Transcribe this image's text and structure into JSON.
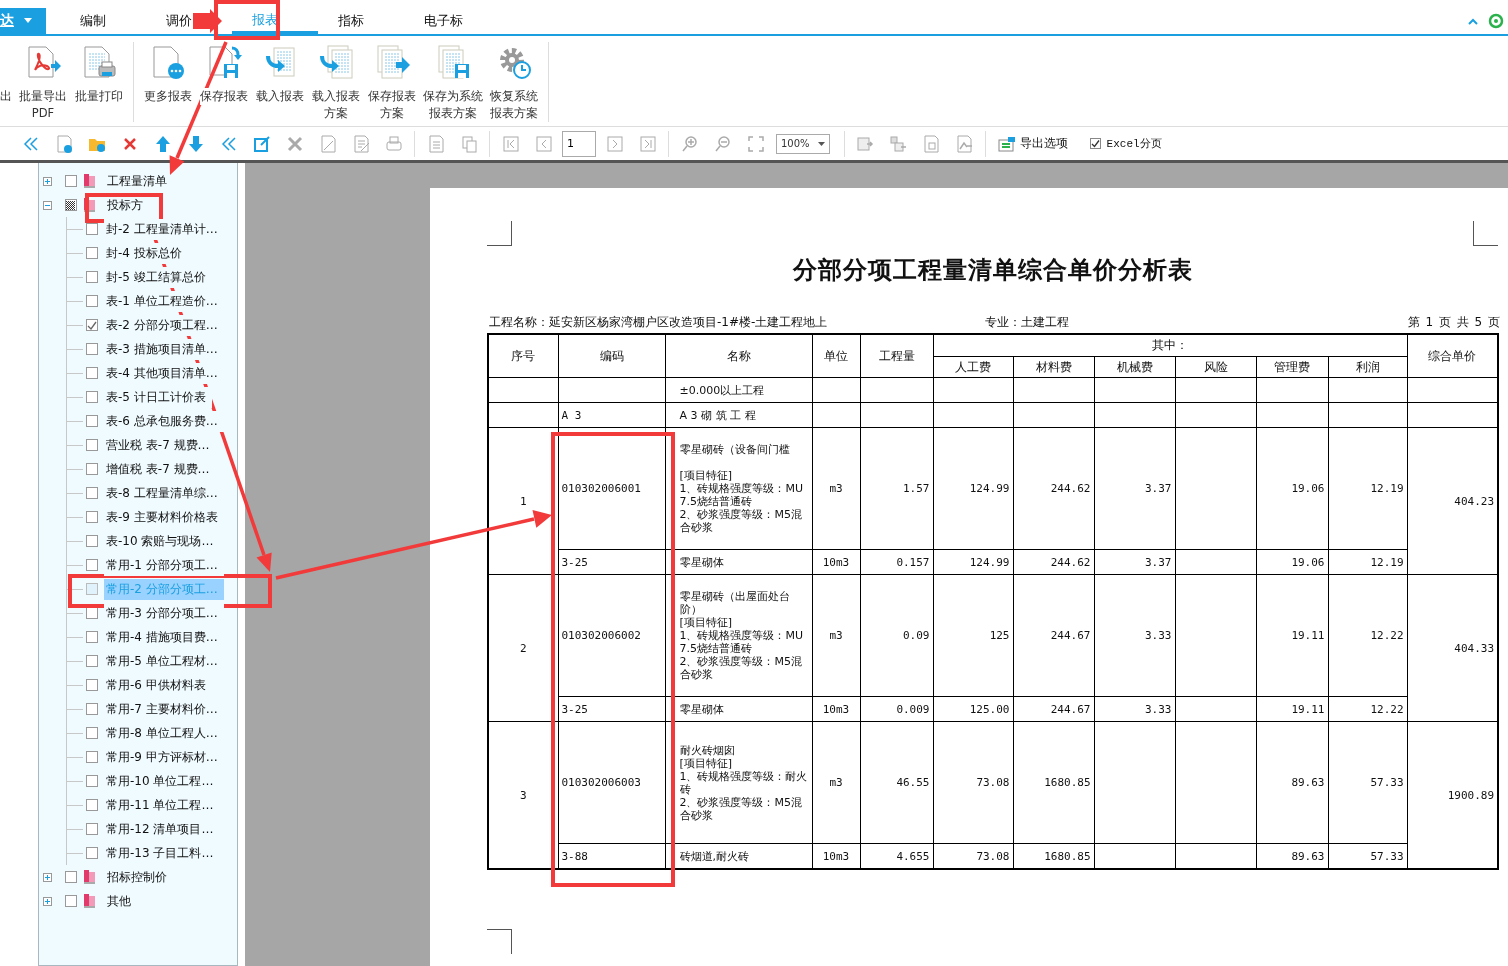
{
  "app_menu": {
    "label": "达"
  },
  "tabs": [
    {
      "label": "编制",
      "selected": false
    },
    {
      "label": "调价",
      "selected": false
    },
    {
      "label": "报表",
      "selected": true
    },
    {
      "label": "指标",
      "selected": false
    },
    {
      "label": "电子标",
      "selected": false
    }
  ],
  "ribbon": [
    {
      "kind": "cut",
      "lines": [
        "出"
      ]
    },
    {
      "kind": "pdf",
      "lines": [
        "批量导出",
        "PDF"
      ]
    },
    {
      "kind": "print",
      "lines": [
        "批量打印"
      ]
    },
    {
      "kind": "more",
      "lines": [
        "更多报表"
      ],
      "separator_before": true
    },
    {
      "kind": "save",
      "lines": [
        "保存报表"
      ]
    },
    {
      "kind": "load",
      "lines": [
        "载入报表"
      ]
    },
    {
      "kind": "load_scheme",
      "lines": [
        "载入报表",
        "方案"
      ]
    },
    {
      "kind": "save_scheme",
      "lines": [
        "保存报表",
        "方案"
      ]
    },
    {
      "kind": "save_system",
      "lines": [
        "保存为系统",
        "报表方案"
      ]
    },
    {
      "kind": "restore",
      "lines": [
        "恢复系统",
        "报表方案"
      ]
    }
  ],
  "report_toolbar": {
    "page_field": "1",
    "zoom": "100%",
    "export_options": "导出选项",
    "excel_paging": {
      "label": "Excel分页",
      "checked": true
    }
  },
  "tree": [
    {
      "label": "工程量清单",
      "expanded": false,
      "checked": false,
      "mixed": false
    },
    {
      "label": "投标方",
      "expanded": true,
      "checked": false,
      "mixed": true,
      "children": [
        {
          "label": "封-2 工程量清单计…",
          "checked": false,
          "selected": false
        },
        {
          "label": "封-4 投标总价",
          "checked": false,
          "selected": false
        },
        {
          "label": "封-5 竣工结算总价",
          "checked": false,
          "selected": false
        },
        {
          "label": "表-1 单位工程造价…",
          "checked": false,
          "selected": false
        },
        {
          "label": "表-2 分部分项工程…",
          "checked": true,
          "selected": false
        },
        {
          "label": "表-3 措施项目清单…",
          "checked": false,
          "selected": false
        },
        {
          "label": "表-4 其他项目清单…",
          "checked": false,
          "selected": false
        },
        {
          "label": "表-5 计日工计价表",
          "checked": false,
          "selected": false
        },
        {
          "label": "表-6 总承包服务费…",
          "checked": false,
          "selected": false
        },
        {
          "label": "营业税 表-7 规费…",
          "checked": false,
          "selected": false
        },
        {
          "label": "增值税 表-7 规费…",
          "checked": false,
          "selected": false
        },
        {
          "label": "表-8 工程量清单综…",
          "checked": false,
          "selected": false
        },
        {
          "label": "表-9 主要材料价格表",
          "checked": false,
          "selected": false
        },
        {
          "label": "表-10 索赔与现场…",
          "checked": false,
          "selected": false
        },
        {
          "label": "常用-1 分部分项工…",
          "checked": false,
          "selected": false
        },
        {
          "label": "常用-2 分部分项工…",
          "checked": false,
          "selected": true
        },
        {
          "label": "常用-3 分部分项工…",
          "checked": false,
          "selected": false
        },
        {
          "label": "常用-4 措施项目费…",
          "checked": false,
          "selected": false
        },
        {
          "label": "常用-5 单位工程材…",
          "checked": false,
          "selected": false
        },
        {
          "label": "常用-6 甲供材料表",
          "checked": false,
          "selected": false
        },
        {
          "label": "常用-7 主要材料价…",
          "checked": false,
          "selected": false
        },
        {
          "label": "常用-8 单位工程人…",
          "checked": false,
          "selected": false
        },
        {
          "label": "常用-9 甲方评标材…",
          "checked": false,
          "selected": false
        },
        {
          "label": "常用-10 单位工程…",
          "checked": false,
          "selected": false
        },
        {
          "label": "常用-11 单位工程…",
          "checked": false,
          "selected": false
        },
        {
          "label": "常用-12 清单项目…",
          "checked": false,
          "selected": false
        },
        {
          "label": "常用-13 子目工料…",
          "checked": false,
          "selected": false
        }
      ]
    },
    {
      "label": "招标控制价",
      "expanded": false,
      "checked": false,
      "mixed": false
    },
    {
      "label": "其他",
      "expanded": false,
      "checked": false,
      "mixed": false
    }
  ],
  "report": {
    "title": "分部分项工程量清单综合单价分析表",
    "project_name": "工程名称：延安新区杨家湾棚户区改造项目-1#楼-土建工程地上",
    "specialty": "专业：土建工程",
    "page_info": "第 1 页  共 5 页",
    "table": {
      "columns": [
        "序号",
        "编码",
        "名称",
        "单位",
        "工程量"
      ],
      "group": {
        "label": "其中：",
        "columns": [
          "人工费",
          "材料费",
          "机械费",
          "风险",
          "管理费",
          "利润"
        ]
      },
      "last_column": "综合单价",
      "rows": [
        {
          "kind": "heading",
          "name": "±0.000以上工程"
        },
        {
          "kind": "heading",
          "code": "A 3",
          "name": "A 3  砌 筑 工 程"
        },
        {
          "kind": "item",
          "no": "1",
          "code": "010302006001",
          "name": "零星砌砖（设备间门槛\n\n[项目特征]\n1、砖规格强度等级：MU7.5烧结普通砖\n2、砂浆强度等级：M5混合砂浆",
          "unit": "m3",
          "qty": "1.57",
          "labor": "124.99",
          "material": "244.62",
          "machine": "3.37",
          "mgmt": "19.06",
          "profit": "12.19",
          "price": "404.23",
          "sub": {
            "code": "3-25",
            "name": "零星砌体",
            "unit": "10m3",
            "qty": "0.157",
            "labor": "124.99",
            "material": "244.62",
            "machine": "3.37",
            "mgmt": "19.06",
            "profit": "12.19"
          }
        },
        {
          "kind": "item",
          "no": "2",
          "code": "010302006002",
          "name": "零星砌砖（出屋面处台阶）\n[项目特征]\n1、砖规格强度等级：MU7.5烧结普通砖\n2、砂浆强度等级：M5混合砂浆",
          "unit": "m3",
          "qty": "0.09",
          "labor": "125",
          "material": "244.67",
          "machine": "3.33",
          "mgmt": "19.11",
          "profit": "12.22",
          "price": "404.33",
          "sub": {
            "code": "3-25",
            "name": "零星砌体",
            "unit": "10m3",
            "qty": "0.009",
            "labor": "125.00",
            "material": "244.67",
            "machine": "3.33",
            "mgmt": "19.11",
            "profit": "12.22"
          }
        },
        {
          "kind": "item",
          "no": "3",
          "code": "010302006003",
          "name": "耐火砖烟囱\n[项目特征]\n1、砖规格强度等级：耐火砖\n2、砂浆强度等级：M5混合砂浆",
          "unit": "m3",
          "qty": "46.55",
          "labor": "73.08",
          "material": "1680.85",
          "mgmt": "89.63",
          "profit": "57.33",
          "price": "1900.89",
          "sub": {
            "code": "3-88",
            "name": "砖烟道,耐火砖",
            "unit": "10m3",
            "qty": "4.655",
            "labor": "73.08",
            "material": "1680.85",
            "mgmt": "89.63",
            "profit": "57.33"
          }
        }
      ]
    }
  }
}
